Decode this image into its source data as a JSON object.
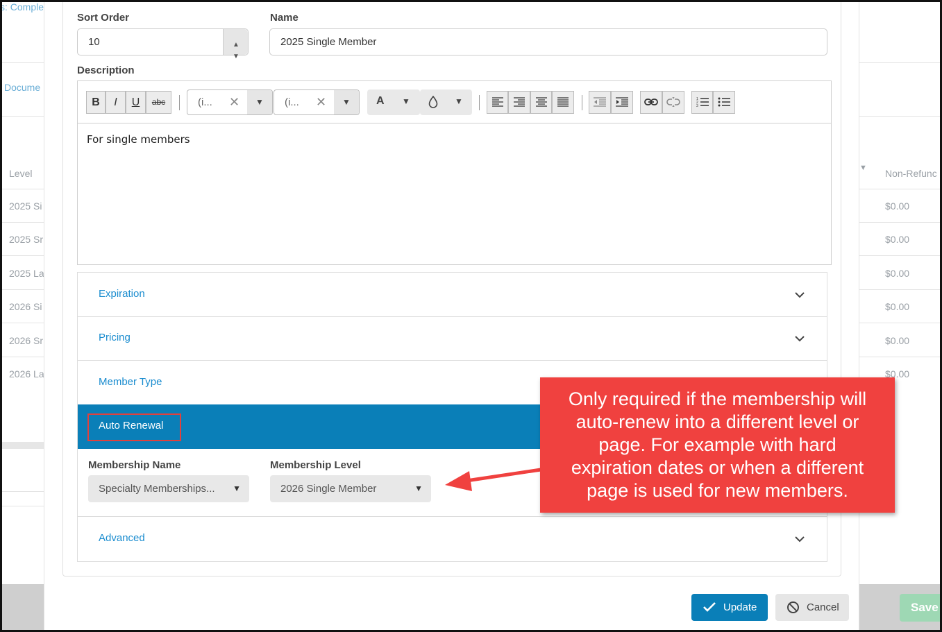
{
  "background": {
    "top_link": "s: Comple",
    "doc_link": "Docume",
    "level_header": "Level",
    "nonrefund_header": "Non-Refunc",
    "rows": [
      {
        "level": "2025 Si",
        "amount": "$0.00"
      },
      {
        "level": "2025 Sr",
        "amount": "$0.00"
      },
      {
        "level": "2025 La",
        "amount": "$0.00"
      },
      {
        "level": "2026 Si",
        "amount": "$0.00"
      },
      {
        "level": "2026 Sr",
        "amount": "$0.00"
      },
      {
        "level": "2026 La",
        "amount": "$0.00"
      }
    ],
    "save_label": "Save"
  },
  "form": {
    "sort_order_label": "Sort Order",
    "sort_order_value": "10",
    "name_label": "Name",
    "name_value": "2025 Single Member",
    "description_label": "Description",
    "description_text": "For single members"
  },
  "toolbar": {
    "bold": "B",
    "italic": "I",
    "underline": "U",
    "strike": "abc",
    "font_family": "(i...",
    "font_size": "(i...",
    "clear": "✕",
    "font_color": "A"
  },
  "accordion": {
    "expiration": "Expiration",
    "pricing": "Pricing",
    "member_type": "Member Type",
    "auto_renewal": "Auto Renewal",
    "advanced": "Advanced"
  },
  "auto_renewal": {
    "membership_name_label": "Membership Name",
    "membership_name_value": "Specialty Memberships...",
    "membership_level_label": "Membership Level",
    "membership_level_value": "2026 Single Member"
  },
  "buttons": {
    "update": "Update",
    "cancel": "Cancel"
  },
  "callout": {
    "line1": "Only required if the membership will",
    "line2": "auto-renew into a different level or",
    "line3": "page. For example with hard",
    "line4": "expiration dates or when a different",
    "line5": "page is used for new members."
  },
  "colors": {
    "primary": "#0a7fb8",
    "link": "#1a8ccf",
    "callout": "#f0413f",
    "highlight_border": "#e0413d"
  }
}
